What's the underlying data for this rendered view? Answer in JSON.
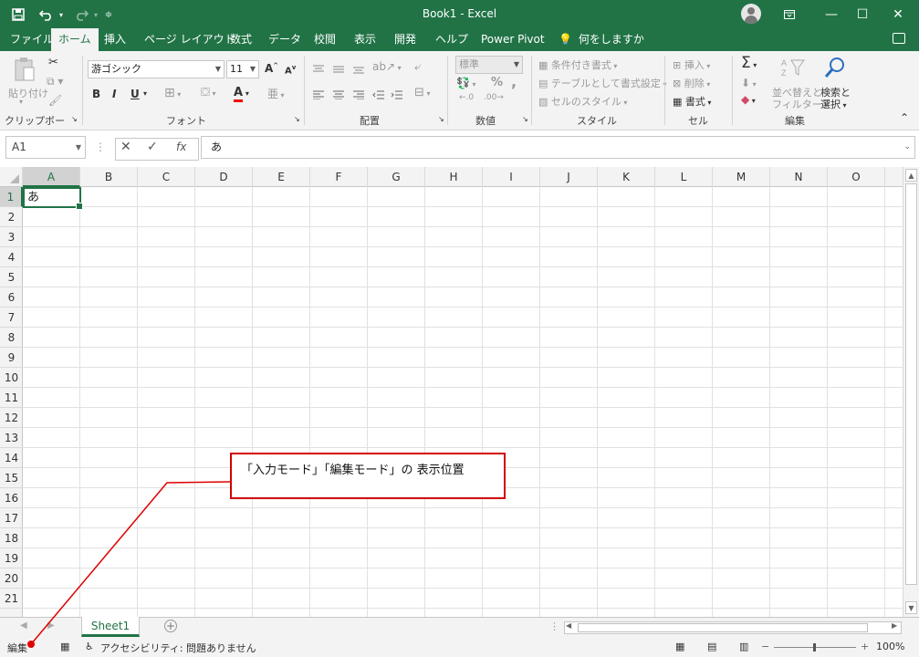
{
  "titlebar": {
    "title": "Book1  -  Excel",
    "quick_access": [
      "save-icon",
      "undo-icon",
      "redo-icon",
      "customize-icon"
    ],
    "window_buttons": [
      "ribbon-display-icon",
      "minimize-icon",
      "maximize-icon",
      "close-icon"
    ]
  },
  "tabs": [
    "ファイル",
    "ホーム",
    "挿入",
    "ページ レイアウト",
    "数式",
    "データ",
    "校閲",
    "表示",
    "開発",
    "ヘルプ",
    "Power Pivot"
  ],
  "active_tab": "ホーム",
  "tell_me": "何をしますか",
  "ribbon": {
    "clipboard": {
      "paste": "貼り付け",
      "label": "クリップボード"
    },
    "font": {
      "name": "游ゴシック",
      "size": "11",
      "bold": "B",
      "italic": "I",
      "underline": "U",
      "grow": "A",
      "shrink": "A",
      "color_letter": "A",
      "label": "フォント"
    },
    "alignment": {
      "label": "配置"
    },
    "number": {
      "format": "標準",
      "percent": "%",
      "comma": ",",
      "label": "数値"
    },
    "styles": {
      "conditional": "条件付き書式",
      "table": "テーブルとして書式設定",
      "cell_styles": "セルのスタイル",
      "label": "スタイル"
    },
    "cells": {
      "insert": "挿入",
      "delete": "削除",
      "format": "書式",
      "label": "セル"
    },
    "editing": {
      "sigma": "Σ",
      "sort": "並べ替えと",
      "sort2": "フィルター",
      "find": "検索と",
      "find2": "選択",
      "label": "編集"
    }
  },
  "formula_bar": {
    "name_box": "A1",
    "fx": "fx",
    "value": "あ"
  },
  "columns": [
    "A",
    "B",
    "C",
    "D",
    "E",
    "F",
    "G",
    "H",
    "I",
    "J",
    "K",
    "L",
    "M",
    "N",
    "O"
  ],
  "rows": [
    "1",
    "2",
    "3",
    "4",
    "5",
    "6",
    "7",
    "8",
    "9",
    "10",
    "11",
    "12",
    "13",
    "14",
    "15",
    "16",
    "17",
    "18",
    "19",
    "20",
    "21"
  ],
  "active_cell": {
    "ref": "A1",
    "value": "あ"
  },
  "sheets": [
    "Sheet1"
  ],
  "status": {
    "mode": "編集",
    "accessibility": "アクセシビリティ: 問題ありません",
    "zoom": "100%"
  },
  "annotation": {
    "text": "「入力モード」「編集モード」の 表示位置"
  },
  "colors": {
    "accent": "#217346",
    "annotation": "#d20000"
  }
}
